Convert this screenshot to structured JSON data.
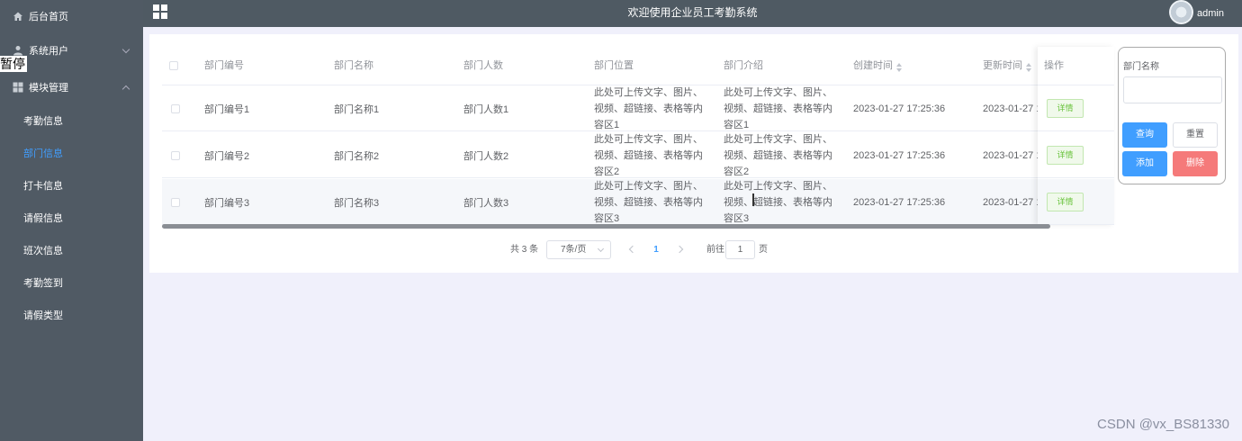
{
  "sidebar": {
    "home": "后台首页",
    "system_users": "系统用户",
    "module_mgmt": "模块管理",
    "sub_items": [
      "考勤信息",
      "部门信息",
      "打卡信息",
      "请假信息",
      "班次信息",
      "考勤签到",
      "请假类型"
    ],
    "active_index": 1,
    "overlay": "暂停"
  },
  "topbar": {
    "title": "欢迎使用企业员工考勤系统",
    "user": "admin"
  },
  "table": {
    "headers": [
      "部门编号",
      "部门名称",
      "部门人数",
      "部门位置",
      "部门介绍",
      "创建时间",
      "更新时间"
    ],
    "action_header": "操作",
    "detail_label": "详情",
    "rows": [
      {
        "code": "部门编号1",
        "name": "部门名称1",
        "count": "部门人数1",
        "location": "此处可上传文字、图片、视频、超链接、表格等内容区1",
        "intro": "此处可上传文字、图片、视频、超链接、表格等内容区1",
        "created": "2023-01-27 17:25:36",
        "updated": "2023-01-27 1"
      },
      {
        "code": "部门编号2",
        "name": "部门名称2",
        "count": "部门人数2",
        "location": "此处可上传文字、图片、视频、超链接、表格等内容区2",
        "intro": "此处可上传文字、图片、视频、超链接、表格等内容区2",
        "created": "2023-01-27 17:25:36",
        "updated": "2023-01-27 1"
      },
      {
        "code": "部门编号3",
        "name": "部门名称3",
        "count": "部门人数3",
        "location": "此处可上传文字、图片、视频、超链接、表格等内容区3",
        "intro": "此处可上传文字、图片、视频、超链接、表格等内容区3",
        "created": "2023-01-27 17:25:36",
        "updated": "2023-01-27 1"
      }
    ]
  },
  "search": {
    "label": "部门名称",
    "query": "查询",
    "reset": "重置",
    "add": "添加",
    "delete": "删除"
  },
  "pagination": {
    "total": "共 3 条",
    "page_size": "7条/页",
    "current_page": "1",
    "goto": "前往",
    "goto_value": "1",
    "page_unit": "页"
  },
  "watermark": "CSDN @vx_BS81330",
  "colors": {
    "sidebar_bg": "#505a64",
    "accent": "#409eff",
    "danger": "#f56c6c",
    "success": "#67c23a"
  }
}
